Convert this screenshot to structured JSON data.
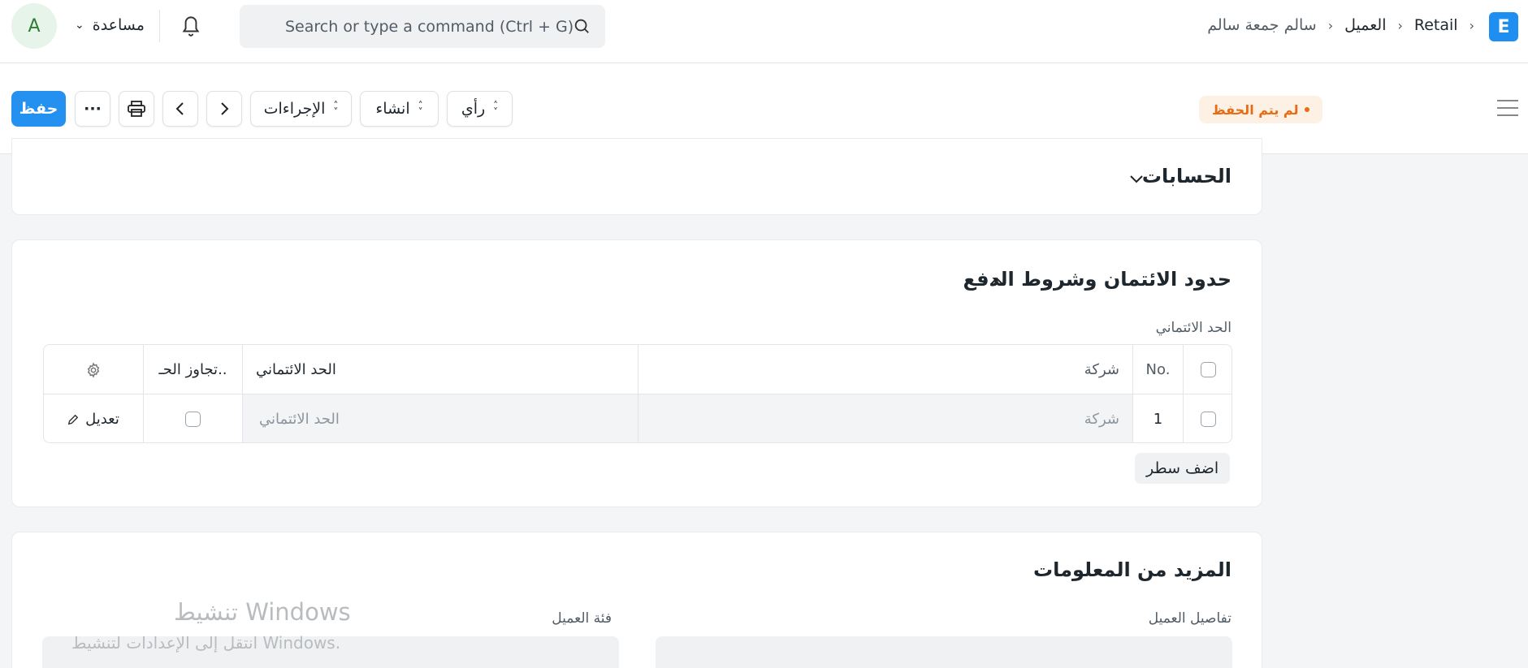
{
  "navbar": {
    "logo_letter": "E",
    "breadcrumb": [
      "Retail",
      "العميل",
      "سالم جمعة سالم"
    ],
    "search_placeholder": "Search or type a command (Ctrl + G)",
    "help_label": "مساعدة",
    "avatar_letter": "A"
  },
  "page_head": {
    "status": "لم يتم الحفظ",
    "save_label": "حفظ",
    "more_label": "···",
    "actions_label": "الإجراءات",
    "create_label": "انشاء",
    "view_label": "رأي"
  },
  "sections": {
    "accounts": {
      "title": "الحسابات"
    },
    "credit": {
      "title": "حدود الائتمان وشروط الدفع",
      "field_label": "الحد الائتماني",
      "table": {
        "headers": {
          "no": "No.",
          "company": "شركة",
          "credit_limit": "الحد الائتماني",
          "bypass": "تجاوز الحـ.."
        },
        "rows": [
          {
            "no": "1",
            "company": "شركة",
            "credit_limit": "الحد الائتماني",
            "edit": "تعديل"
          }
        ]
      },
      "add_row_label": "اضف سطر"
    },
    "more_info": {
      "title": "المزيد من المعلومات",
      "customer_details_label": "تفاصيل العميل",
      "customer_group_label": "فئة العميل"
    }
  },
  "watermark": {
    "title": "تنشيط Windows",
    "subtitle": "انتقل إلى الإعدادات لتنشيط Windows."
  }
}
